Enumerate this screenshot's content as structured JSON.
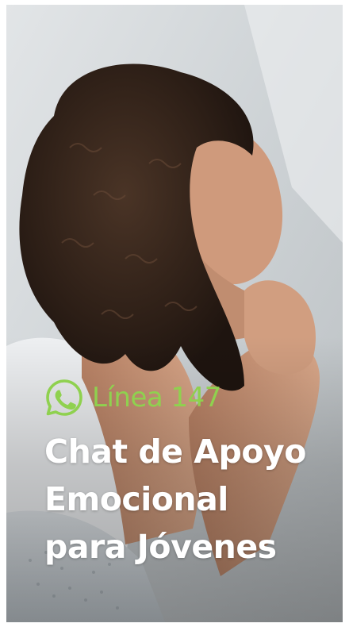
{
  "brand": {
    "icon": "whatsapp-icon",
    "name": "Línea 147",
    "accent_color": "#8fd14f"
  },
  "headline": {
    "line1": "Chat de Apoyo",
    "line2": "Emocional",
    "line3": "para Jóvenes",
    "color": "#ffffff"
  }
}
